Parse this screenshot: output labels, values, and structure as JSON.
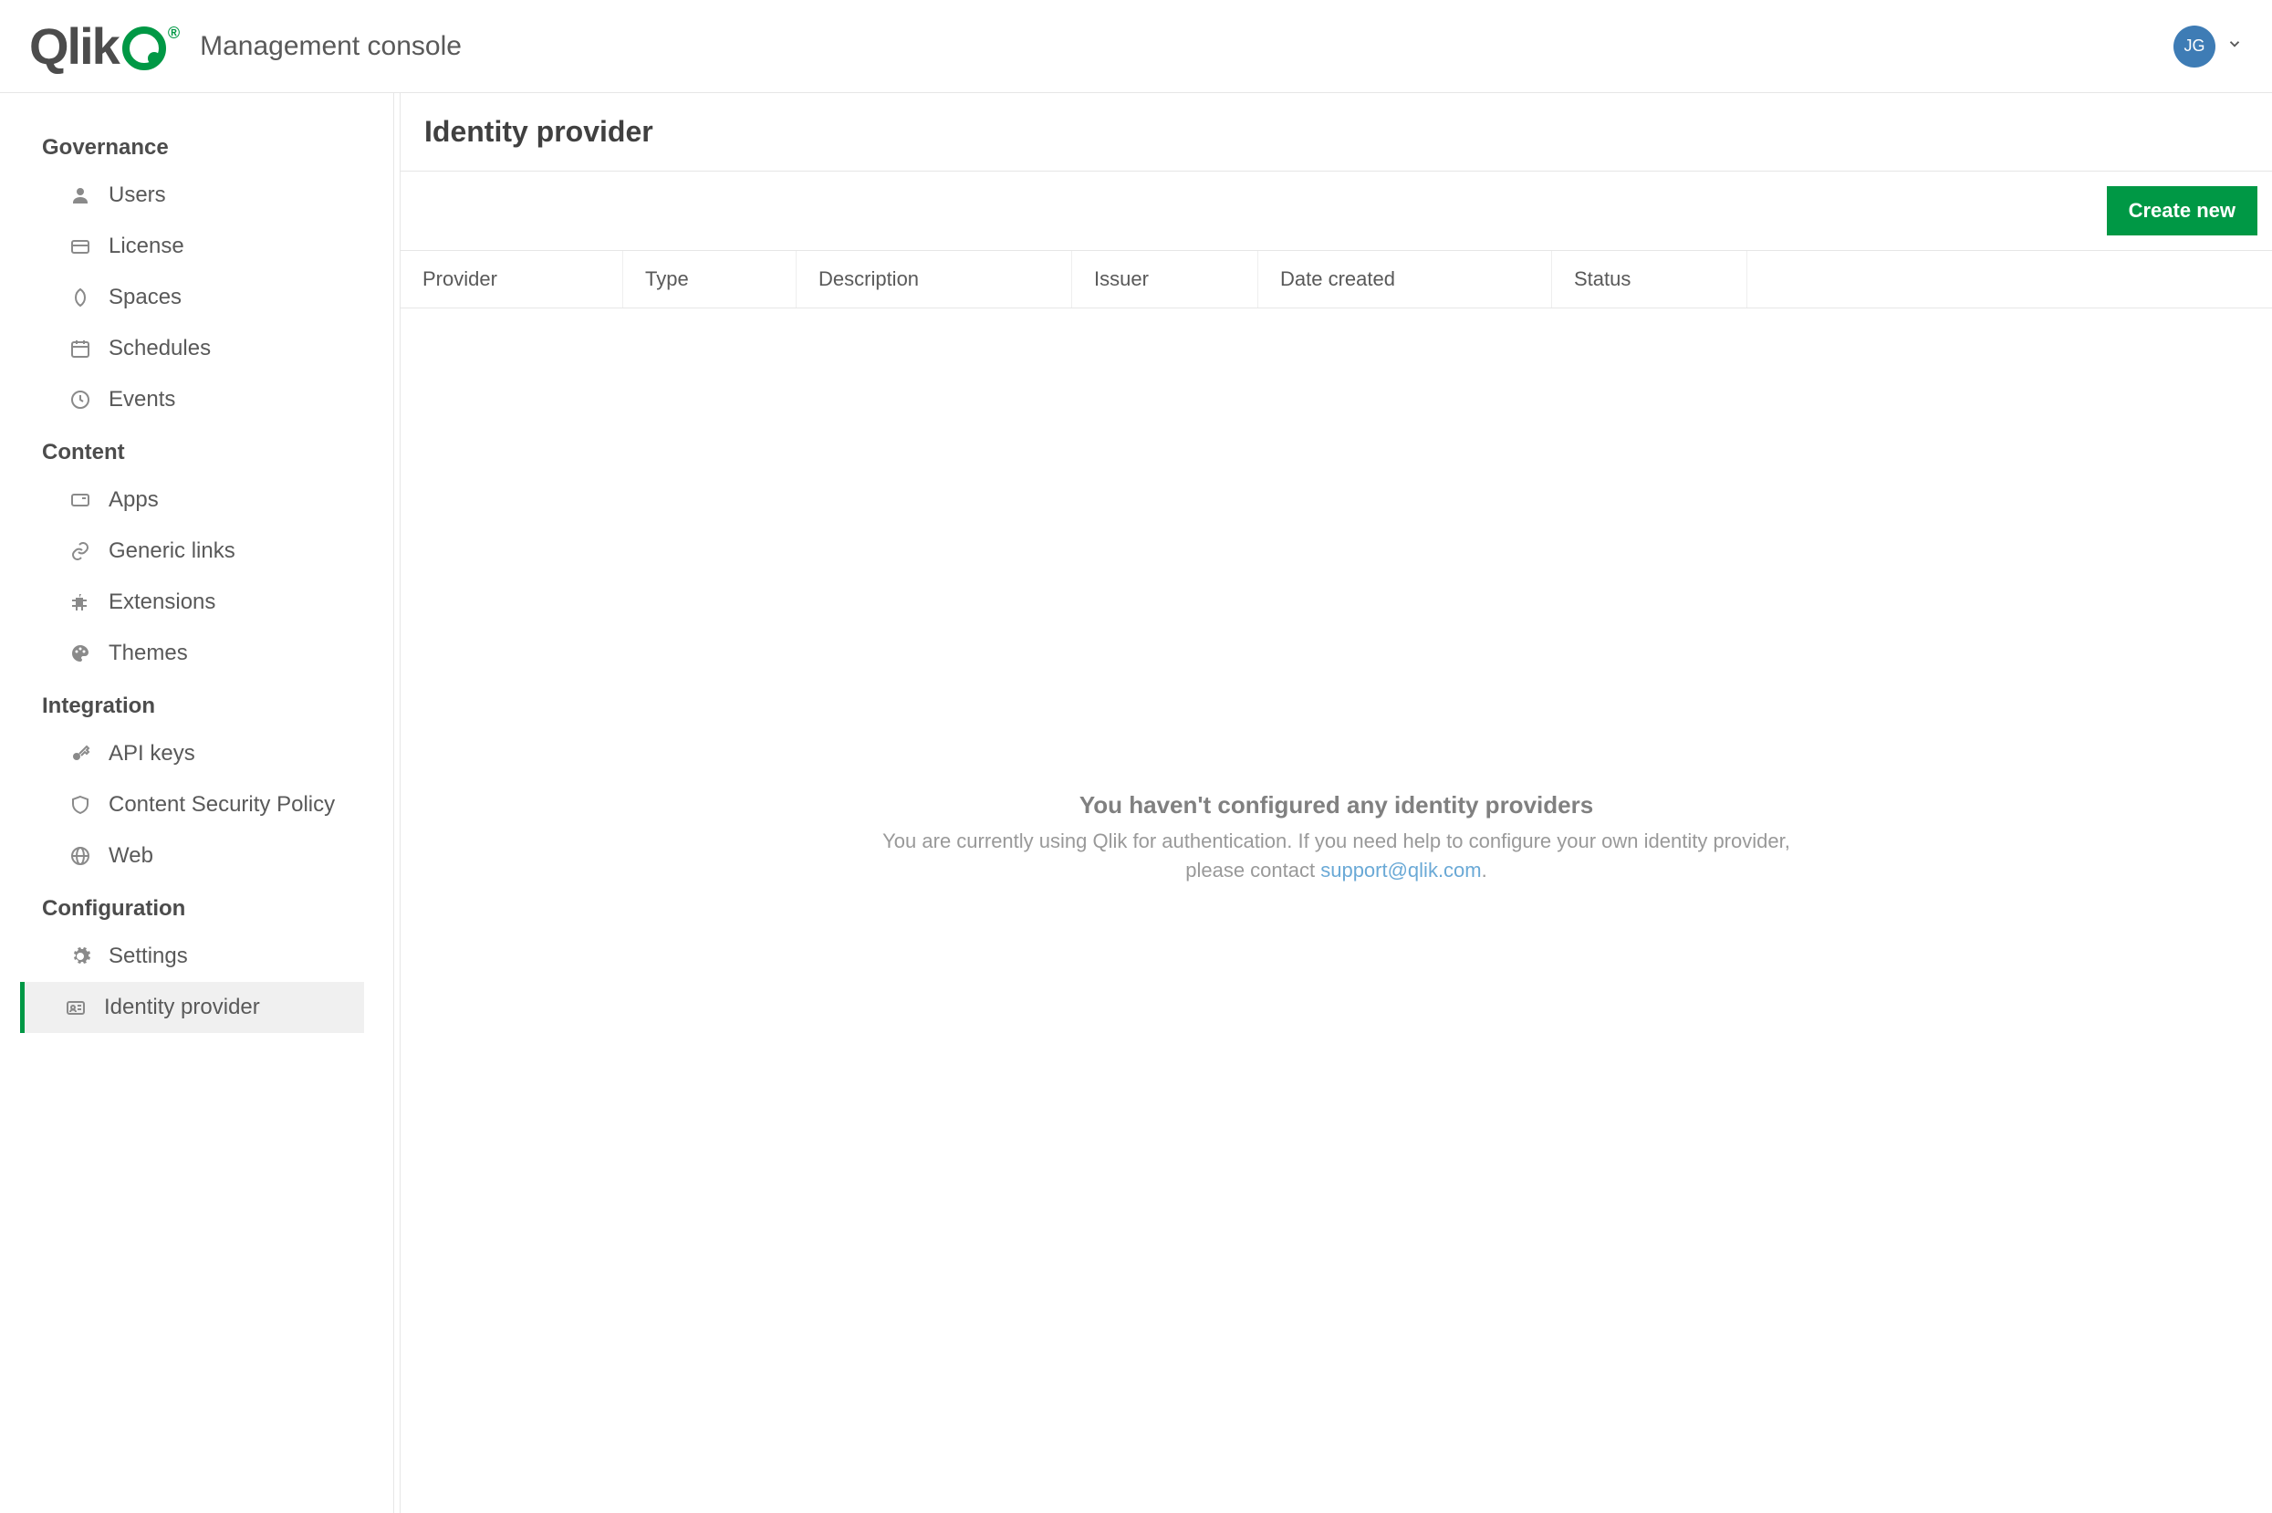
{
  "header": {
    "logo_text": "Qlik",
    "app_title": "Management console",
    "user_initials": "JG"
  },
  "sidebar": {
    "sections": [
      {
        "title": "Governance",
        "items": [
          {
            "label": "Users",
            "icon": "person-icon",
            "active": false
          },
          {
            "label": "License",
            "icon": "license-icon",
            "active": false
          },
          {
            "label": "Spaces",
            "icon": "spaces-icon",
            "active": false
          },
          {
            "label": "Schedules",
            "icon": "calendar-icon",
            "active": false
          },
          {
            "label": "Events",
            "icon": "clock-icon",
            "active": false
          }
        ]
      },
      {
        "title": "Content",
        "items": [
          {
            "label": "Apps",
            "icon": "app-icon",
            "active": false
          },
          {
            "label": "Generic links",
            "icon": "link-icon",
            "active": false
          },
          {
            "label": "Extensions",
            "icon": "puzzle-icon",
            "active": false
          },
          {
            "label": "Themes",
            "icon": "palette-icon",
            "active": false
          }
        ]
      },
      {
        "title": "Integration",
        "items": [
          {
            "label": "API keys",
            "icon": "key-icon",
            "active": false
          },
          {
            "label": "Content Security Policy",
            "icon": "shield-icon",
            "active": false
          },
          {
            "label": "Web",
            "icon": "globe-icon",
            "active": false
          }
        ]
      },
      {
        "title": "Configuration",
        "items": [
          {
            "label": "Settings",
            "icon": "gear-icon",
            "active": false
          },
          {
            "label": "Identity provider",
            "icon": "id-icon",
            "active": true
          }
        ]
      }
    ]
  },
  "main": {
    "page_title": "Identity provider",
    "create_button": "Create new",
    "columns": [
      "Provider",
      "Type",
      "Description",
      "Issuer",
      "Date created",
      "Status"
    ],
    "empty_title": "You haven't configured any identity providers",
    "empty_text_before": "You are currently using Qlik for authentication. If you need help to configure your own identity provider, please contact ",
    "empty_link": "support@qlik.com",
    "empty_text_after": "."
  }
}
